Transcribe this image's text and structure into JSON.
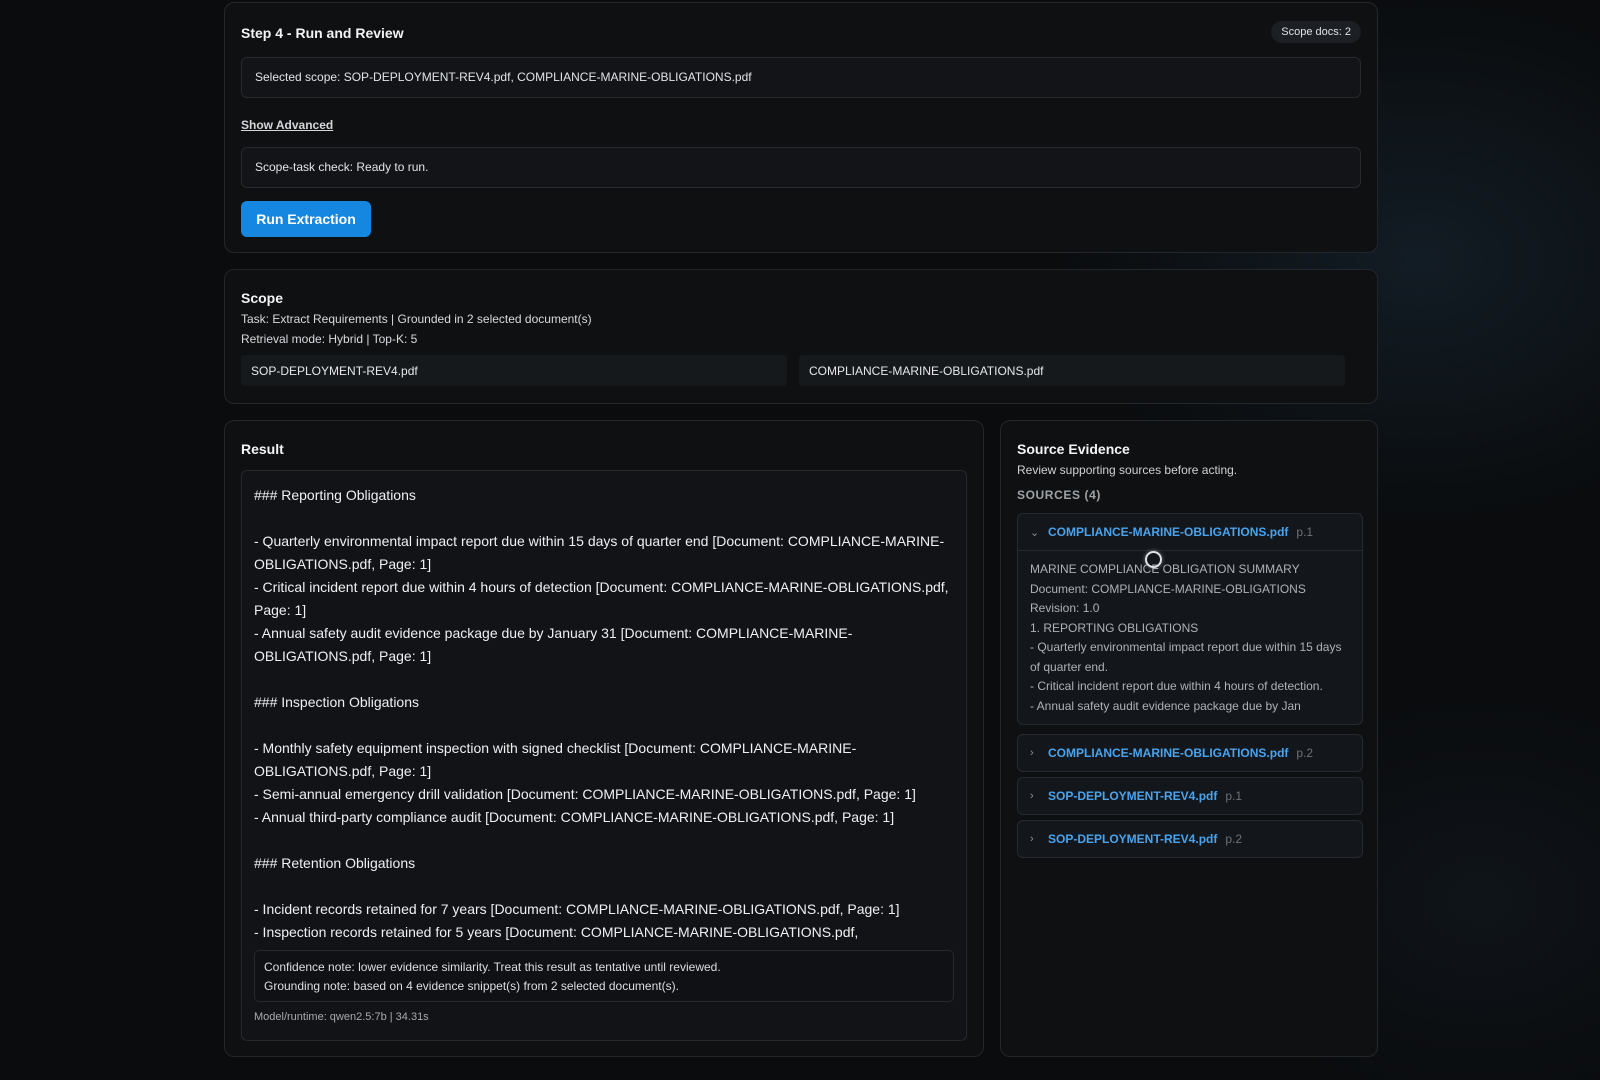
{
  "step4": {
    "title": "Step 4 - Run and Review",
    "badge": "Scope docs: 2",
    "selected_scope": "Selected scope: SOP-DEPLOYMENT-REV4.pdf, COMPLIANCE-MARINE-OBLIGATIONS.pdf",
    "advanced_link": "Show Advanced",
    "scope_check": "Scope-task check: Ready to run.",
    "run_button": "Run Extraction",
    "run_button_color": "#1587e0"
  },
  "scope": {
    "title": "Scope",
    "task_line": "Task: Extract Requirements | Grounded in 2 selected document(s)",
    "mode_line": "Retrieval mode: Hybrid | Top-K: 5",
    "documents": [
      "SOP-DEPLOYMENT-REV4.pdf",
      "COMPLIANCE-MARINE-OBLIGATIONS.pdf"
    ]
  },
  "result": {
    "title": "Result",
    "text": "### Reporting Obligations\n\n- Quarterly environmental impact report due within 15 days of quarter end [Document: COMPLIANCE-MARINE-OBLIGATIONS.pdf, Page: 1]\n- Critical incident report due within 4 hours of detection [Document: COMPLIANCE-MARINE-OBLIGATIONS.pdf, Page: 1]\n- Annual safety audit evidence package due by January 31 [Document: COMPLIANCE-MARINE-OBLIGATIONS.pdf, Page: 1]\n\n### Inspection Obligations\n\n- Monthly safety equipment inspection with signed checklist [Document: COMPLIANCE-MARINE-OBLIGATIONS.pdf, Page: 1]\n- Semi-annual emergency drill validation [Document: COMPLIANCE-MARINE-OBLIGATIONS.pdf, Page: 1]\n- Annual third-party compliance audit [Document: COMPLIANCE-MARINE-OBLIGATIONS.pdf, Page: 1]\n\n### Retention Obligations\n\n- Incident records retained for 7 years [Document: COMPLIANCE-MARINE-OBLIGATIONS.pdf, Page: 1]\n- Inspection records retained for 5 years [Document: COMPLIANCE-MARINE-OBLIGATIONS.pdf,",
    "confidence_note": "Confidence note: lower evidence similarity. Treat this result as tentative until reviewed.",
    "grounding_note": "Grounding note: based on 4 evidence snippet(s) from 2 selected document(s).",
    "runtime": "Model/runtime: qwen2.5:7b | 34.31s"
  },
  "evidence": {
    "title": "Source Evidence",
    "subtitle": "Review supporting sources before acting.",
    "count_label": "SOURCES (4)",
    "link_color": "#4aa3ee",
    "sources": [
      {
        "name": "COMPLIANCE-MARINE-OBLIGATIONS.pdf",
        "page": "p.1",
        "expanded": true,
        "snippet": "MARINE COMPLIANCE OBLIGATION SUMMARY\nDocument: COMPLIANCE-MARINE-OBLIGATIONS\nRevision: 1.0\n1. REPORTING OBLIGATIONS\n- Quarterly environmental impact report due within 15 days of quarter end.\n- Critical incident report due within 4 hours of detection.\n- Annual safety audit evidence package due by Jan"
      },
      {
        "name": "COMPLIANCE-MARINE-OBLIGATIONS.pdf",
        "page": "p.2",
        "expanded": false
      },
      {
        "name": "SOP-DEPLOYMENT-REV4.pdf",
        "page": "p.1",
        "expanded": false
      },
      {
        "name": "SOP-DEPLOYMENT-REV4.pdf",
        "page": "p.2",
        "expanded": false
      }
    ]
  },
  "icons": {
    "expanded": "chevron-down-icon",
    "collapsed": "chevron-right-icon"
  }
}
